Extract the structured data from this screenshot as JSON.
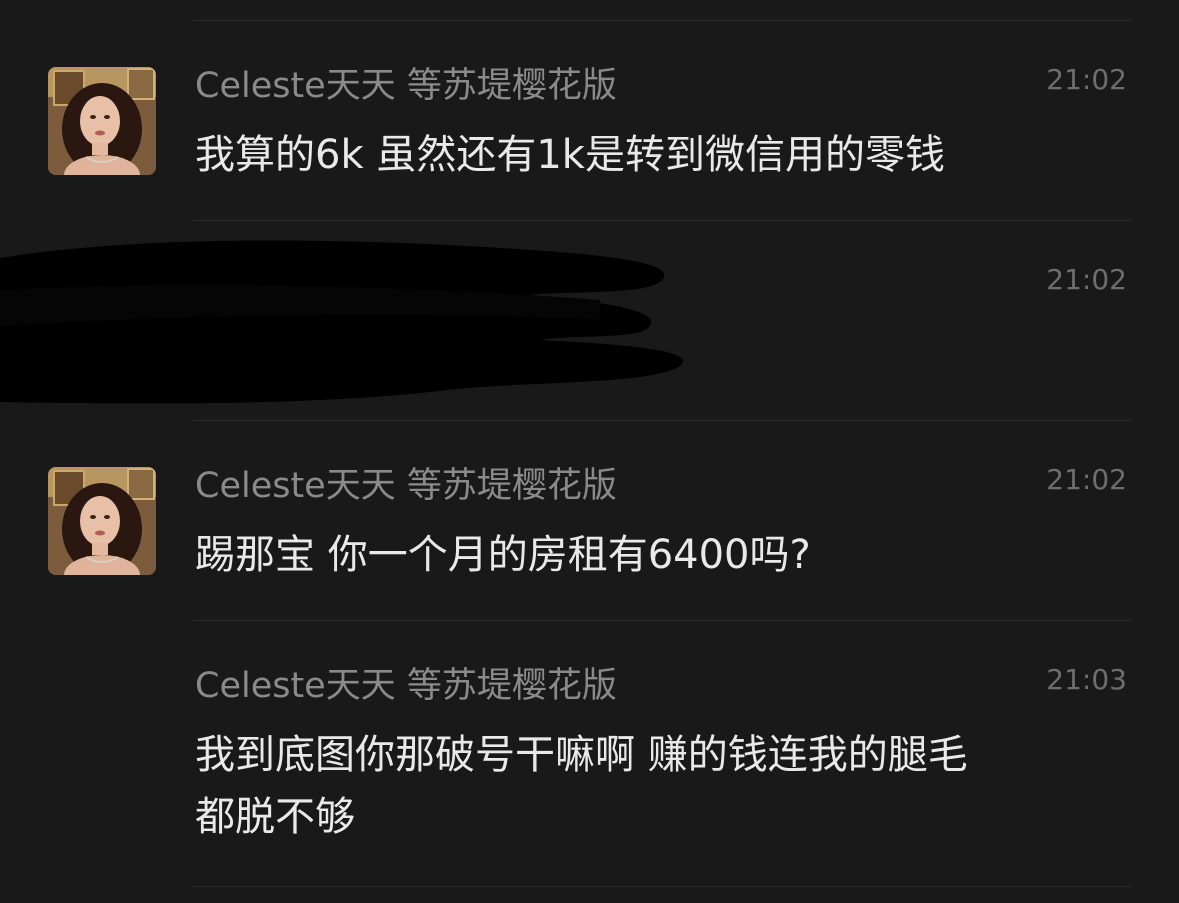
{
  "messages": [
    {
      "sender": "Celeste天天 等苏堤樱花版",
      "time": "21:02",
      "text": "我算的6k 虽然还有1k是转到微信用的零钱",
      "avatar": "woman-portrait"
    },
    {
      "sender": "",
      "time": "21:02",
      "text": "",
      "redacted": true
    },
    {
      "sender": "Celeste天天 等苏堤樱花版",
      "time": "21:02",
      "text": "踢那宝 你一个月的房租有6400吗?",
      "avatar": "woman-portrait"
    },
    {
      "sender": "Celeste天天 等苏堤樱花版",
      "time": "21:03",
      "text": "我到底图你那破号干嘛啊 赚的钱连我的腿毛\n都脱不够"
    }
  ],
  "colors": {
    "background": "#191919",
    "divider": "#2c2c2c",
    "sender": "#8a8a8a",
    "time": "#6e6e6e",
    "text": "#e9e9e9",
    "redaction": "#000000"
  }
}
